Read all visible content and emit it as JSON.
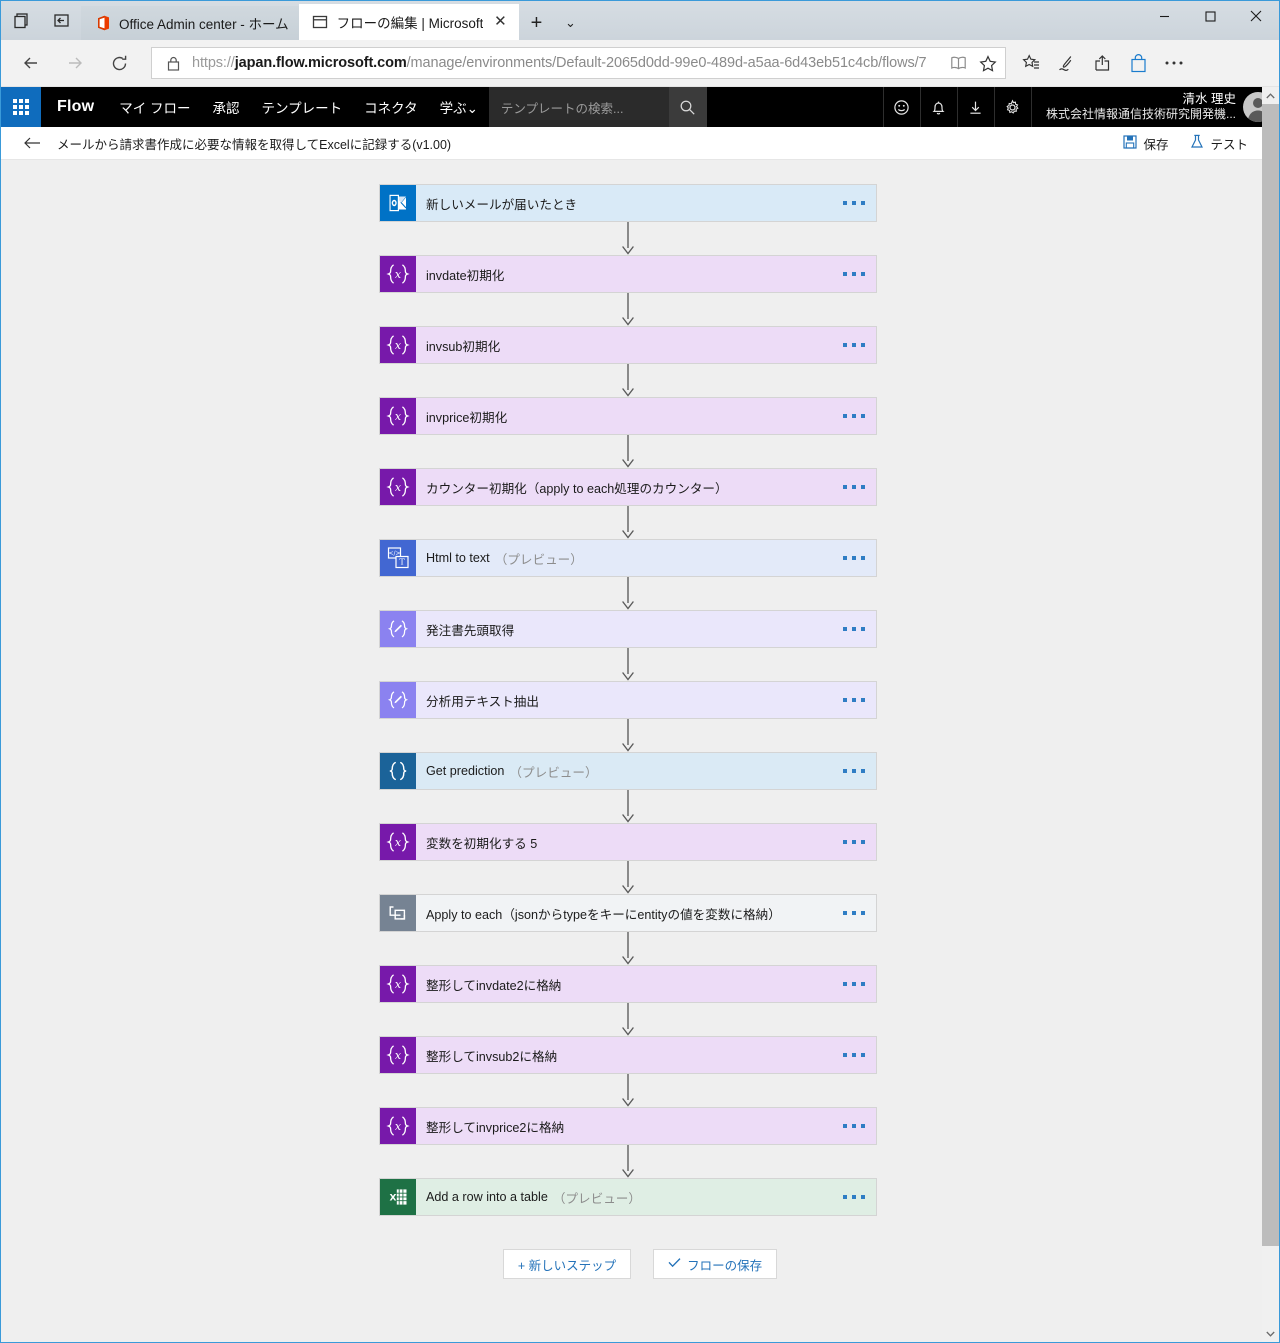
{
  "browser": {
    "tabs": [
      {
        "title": "Office Admin center - ホーム",
        "icon": "office-icon",
        "active": false
      },
      {
        "title": "フローの編集 | Microsoft",
        "icon": "window-icon",
        "active": true
      }
    ],
    "new_tab_label": "+",
    "tab_menu_label": "⌄",
    "url_prefix": "https://",
    "url_domain": "japan.flow.microsoft.com",
    "url_rest": "/manage/environments/Default-2065d0dd-99e0-489d-a5aa-6d43eb51c4cb/flows/7",
    "window_controls": {
      "minimize": "minimize-icon",
      "maximize": "maximize-icon",
      "close": "close-icon"
    },
    "toolbar_icons": [
      "reading-list-icon",
      "notes-icon",
      "share-icon",
      "shopping-icon",
      "more-icon"
    ]
  },
  "flow_header": {
    "waffle": "app-launcher-icon",
    "brand": "Flow",
    "nav": [
      {
        "label": "マイ フロー"
      },
      {
        "label": "承認"
      },
      {
        "label": "テンプレート"
      },
      {
        "label": "コネクタ"
      },
      {
        "label": "学ぶ⌄"
      }
    ],
    "search_placeholder": "テンプレートの検索...",
    "icons": [
      "feedback-icon",
      "bell-icon",
      "download-icon",
      "gear-icon"
    ],
    "user_name": "清水 理史",
    "user_org": "株式会社情報通信技術研究開発機...",
    "avatar": "avatar"
  },
  "command_bar": {
    "back": "back-arrow-icon",
    "title": "メールから請求書作成に必要な情報を取得してExcelに記録する(v1.00)",
    "save_label": "保存",
    "test_label": "テスト"
  },
  "designer": {
    "steps": [
      {
        "label": "新しいメールが届いたとき",
        "preview": "",
        "icon": "outlook-icon",
        "icon_bg": "#0072c6",
        "card_bg": "#d9eaf7"
      },
      {
        "label": "invdate初期化",
        "preview": "",
        "icon": "variable-icon",
        "icon_bg": "#7719aa",
        "card_bg": "#eddcf7"
      },
      {
        "label": "invsub初期化",
        "preview": "",
        "icon": "variable-icon",
        "icon_bg": "#7719aa",
        "card_bg": "#eddcf7"
      },
      {
        "label": "invprice初期化",
        "preview": "",
        "icon": "variable-icon",
        "icon_bg": "#7719aa",
        "card_bg": "#eddcf7"
      },
      {
        "label": "カウンター初期化（apply to each処理のカウンター）",
        "preview": "",
        "icon": "variable-icon",
        "icon_bg": "#7719aa",
        "card_bg": "#eddcf7"
      },
      {
        "label": "Html to text",
        "preview": "（プレビュー）",
        "icon": "html-to-text-icon",
        "icon_bg": "#4267d2",
        "card_bg": "#e3eaf9"
      },
      {
        "label": "発注書先頭取得",
        "preview": "",
        "icon": "compose-icon",
        "icon_bg": "#8b82f0",
        "card_bg": "#eae7fb"
      },
      {
        "label": "分析用テキスト抽出",
        "preview": "",
        "icon": "compose-icon",
        "icon_bg": "#8b82f0",
        "card_bg": "#eae7fb"
      },
      {
        "label": "Get prediction",
        "preview": "（プレビュー）",
        "icon": "json-icon",
        "icon_bg": "#1b6399",
        "card_bg": "#daeaf5"
      },
      {
        "label": "変数を初期化する 5",
        "preview": "",
        "icon": "variable-icon",
        "icon_bg": "#7719aa",
        "card_bg": "#eddcf7"
      },
      {
        "label": "Apply to each（jsonからtypeをキーにentityの値を変数に格納）",
        "preview": "",
        "icon": "apply-to-each-icon",
        "icon_bg": "#768393",
        "card_bg": "#f1f3f5"
      },
      {
        "label": "整形してinvdate2に格納",
        "preview": "",
        "icon": "variable-icon",
        "icon_bg": "#7719aa",
        "card_bg": "#eddcf7"
      },
      {
        "label": "整形してinvsub2に格納",
        "preview": "",
        "icon": "variable-icon",
        "icon_bg": "#7719aa",
        "card_bg": "#eddcf7"
      },
      {
        "label": "整形してinvprice2に格納",
        "preview": "",
        "icon": "variable-icon",
        "icon_bg": "#7719aa",
        "card_bg": "#eddcf7"
      },
      {
        "label": "Add a row into a table",
        "preview": "（プレビュー）",
        "icon": "excel-icon",
        "icon_bg": "#1e7145",
        "card_bg": "#dfeee4"
      }
    ],
    "actions": {
      "new_step": "+ 新しいステップ",
      "save_flow": "フローの保存",
      "save_flow_icon": "check-icon"
    }
  },
  "colors": {
    "accent_blue": "#2372b9",
    "variable_purple": "#7719aa",
    "excel_green": "#1e7145",
    "outlook_blue": "#0072c6"
  }
}
